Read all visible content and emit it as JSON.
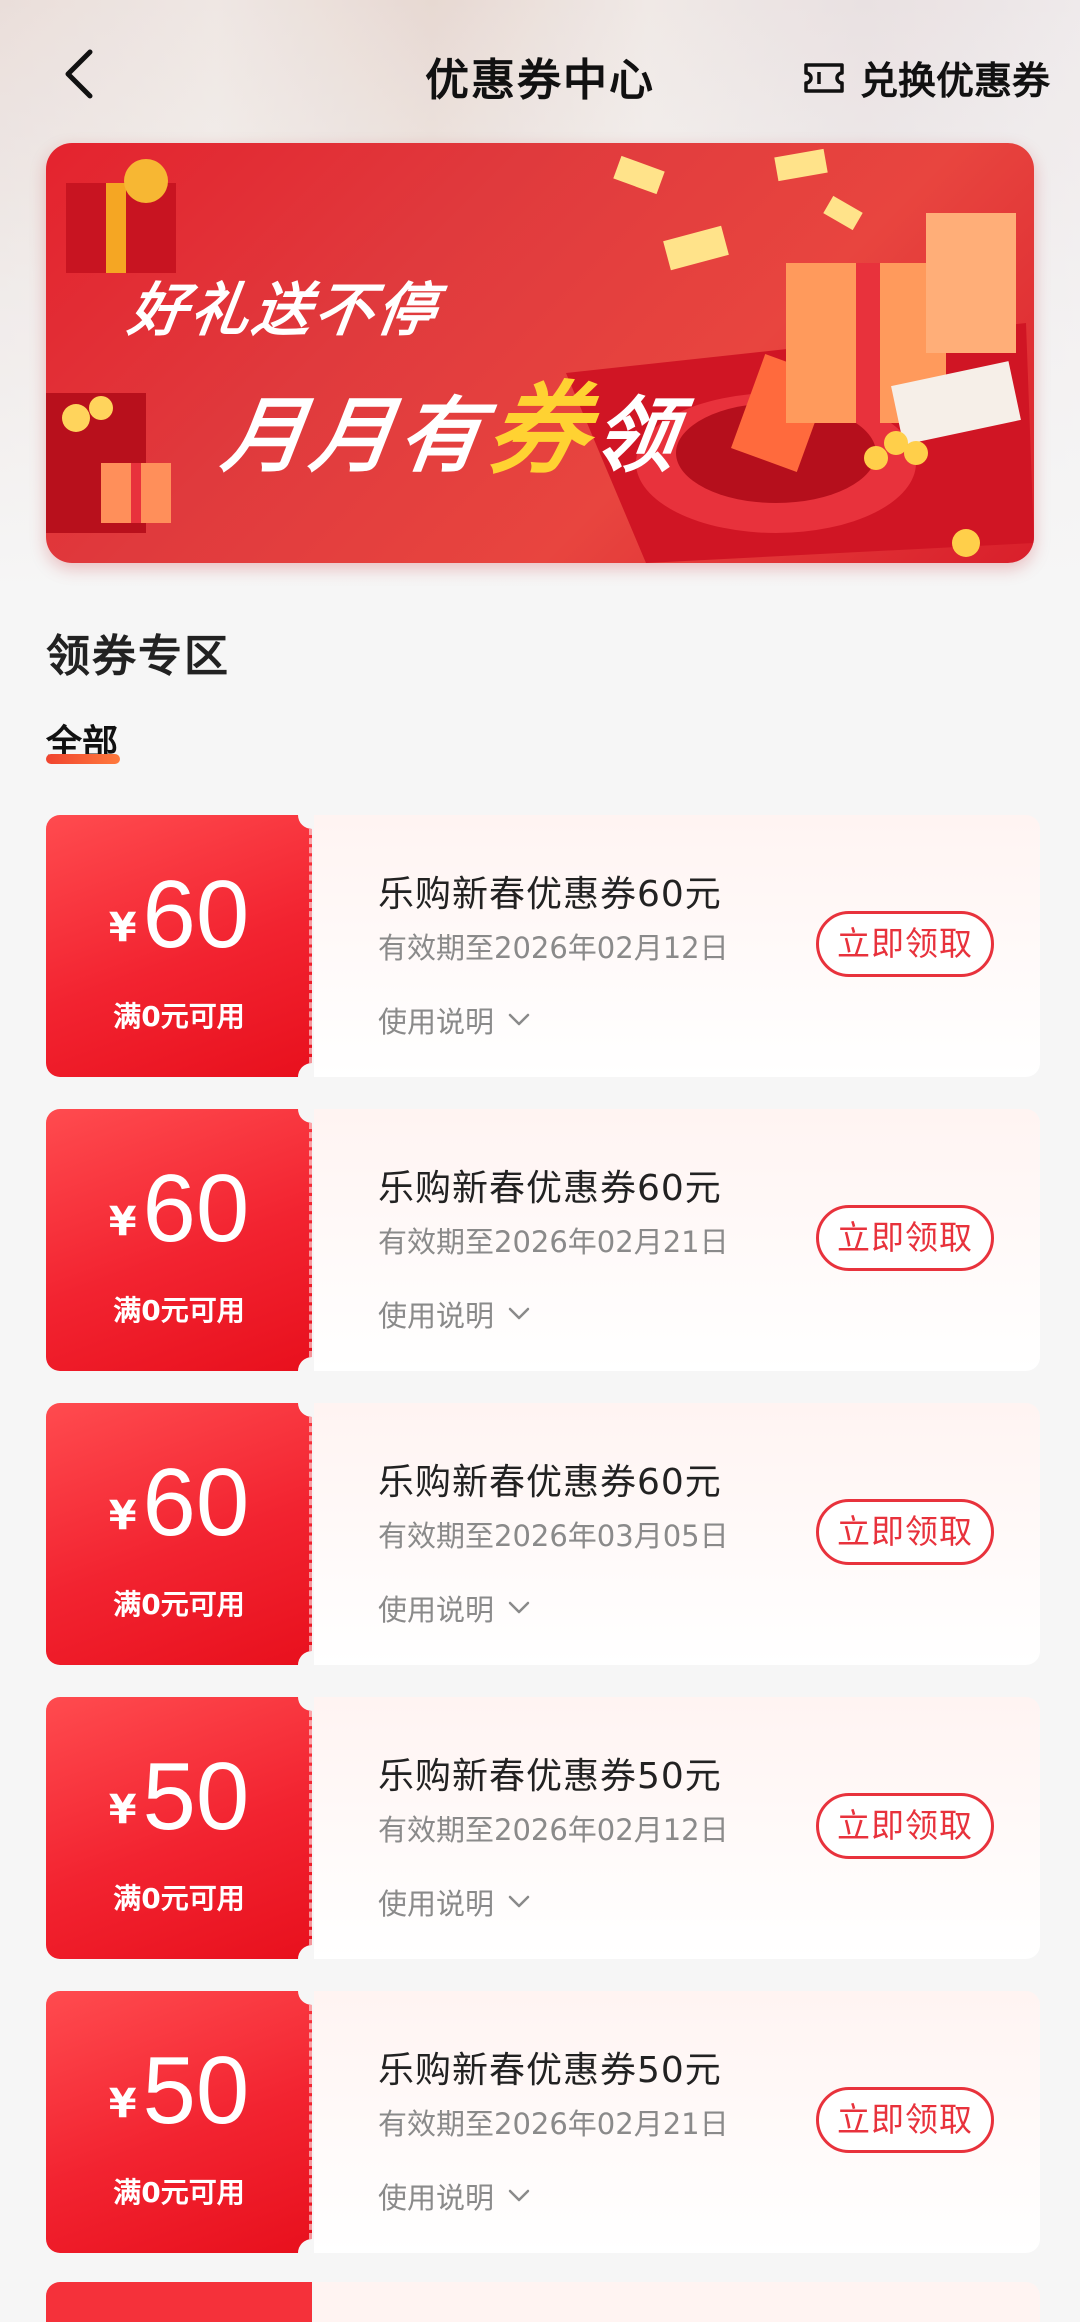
{
  "header": {
    "title": "优惠券中心",
    "exchange_label": "兑换优惠券"
  },
  "banner": {
    "line1": "好礼送不停",
    "line2_a": "月月有",
    "line2_highlight": "券",
    "line2_b": "领"
  },
  "section": {
    "title": "领券专区",
    "tab_all": "全部"
  },
  "colors": {
    "accent": "#e8323c",
    "coupon_red": "#f22330",
    "highlight_yellow": "#ffd232"
  },
  "coupons": [
    {
      "currency": "¥",
      "amount": "60",
      "threshold": "满0元可用",
      "title": "乐购新春优惠券60元",
      "valid_until": "有效期至2026年02月12日",
      "usage_label": "使用说明",
      "button_label": "立即领取"
    },
    {
      "currency": "¥",
      "amount": "60",
      "threshold": "满0元可用",
      "title": "乐购新春优惠券60元",
      "valid_until": "有效期至2026年02月21日",
      "usage_label": "使用说明",
      "button_label": "立即领取"
    },
    {
      "currency": "¥",
      "amount": "60",
      "threshold": "满0元可用",
      "title": "乐购新春优惠券60元",
      "valid_until": "有效期至2026年03月05日",
      "usage_label": "使用说明",
      "button_label": "立即领取"
    },
    {
      "currency": "¥",
      "amount": "50",
      "threshold": "满0元可用",
      "title": "乐购新春优惠券50元",
      "valid_until": "有效期至2026年02月12日",
      "usage_label": "使用说明",
      "button_label": "立即领取"
    },
    {
      "currency": "¥",
      "amount": "50",
      "threshold": "满0元可用",
      "title": "乐购新春优惠券50元",
      "valid_until": "有效期至2026年02月21日",
      "usage_label": "使用说明",
      "button_label": "立即领取"
    }
  ]
}
